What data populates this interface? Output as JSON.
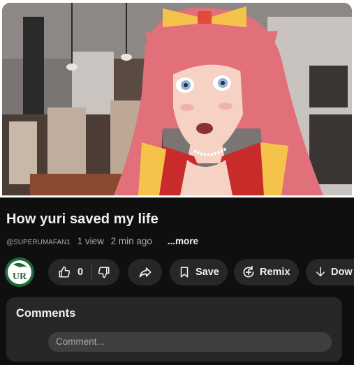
{
  "video": {
    "description_icon": "anime-girl-avatar-over-kitchen-photo"
  },
  "title": "How yuri saved my life",
  "meta": {
    "handle": "@SUPERUMAFAN1",
    "views": "1 view",
    "age": "2 min ago",
    "more": "...more"
  },
  "channel": {
    "avatar_text": "UR",
    "avatar_color": "#1e6b3a"
  },
  "actions": {
    "like_count": "0",
    "save": "Save",
    "remix": "Remix",
    "download": "Dow"
  },
  "comments": {
    "heading": "Comments",
    "placeholder": "Comment..."
  },
  "colors": {
    "background": "#0f0f0f",
    "pill": "#272727",
    "text": "#f1f1f1",
    "muted": "#aaaaaa"
  }
}
